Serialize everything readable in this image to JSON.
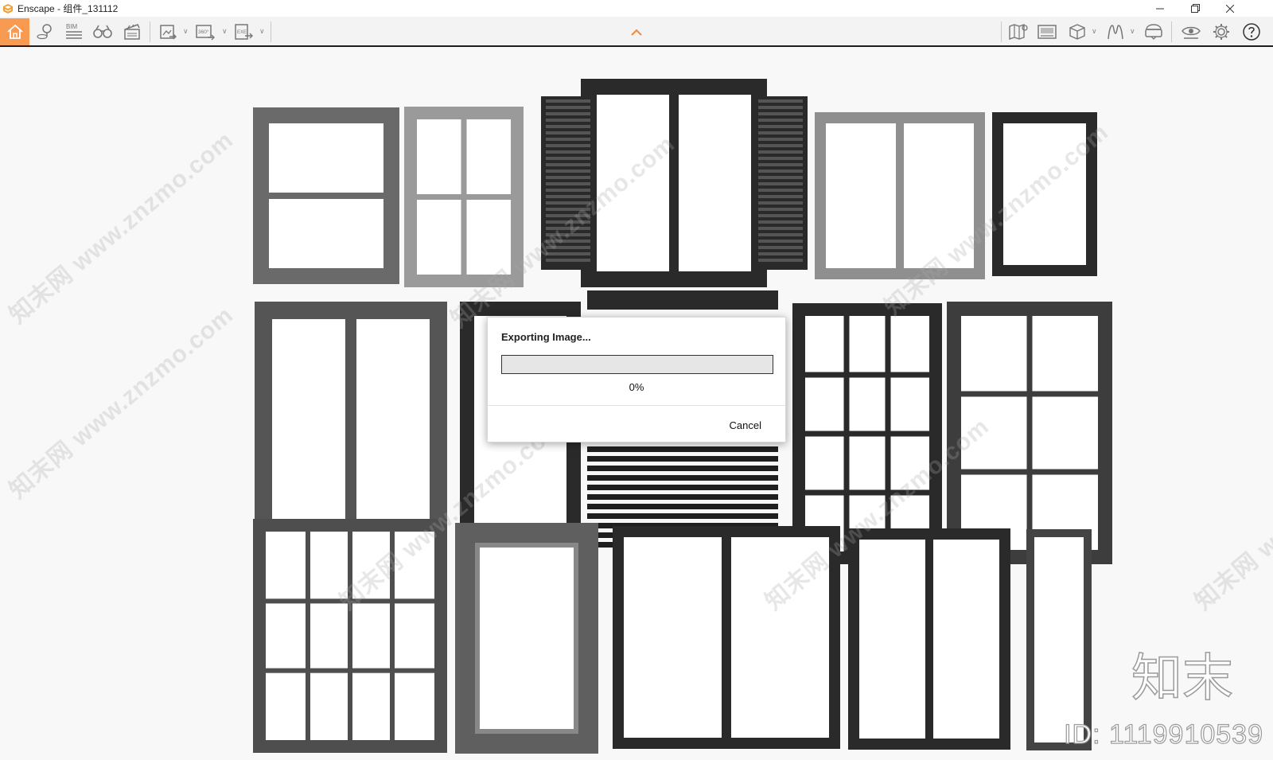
{
  "window": {
    "title": "Enscape - 组件_131112",
    "controls": [
      "minimize-icon",
      "restore-icon",
      "close-icon"
    ]
  },
  "toolbar": {
    "left": [
      {
        "name": "home-icon",
        "active": true
      },
      {
        "name": "map-pin-icon"
      },
      {
        "name": "bim-icon",
        "label": "BIM"
      },
      {
        "name": "binoculars-icon"
      },
      {
        "name": "clapperboard-icon"
      },
      {
        "name": "screenshot-export-icon",
        "dropdown": true
      },
      {
        "name": "panorama-export-icon",
        "label": "360°",
        "dropdown": true
      },
      {
        "name": "exe-export-icon",
        "label": "EXE",
        "dropdown": true
      }
    ],
    "center": {
      "name": "chevron-up-icon"
    },
    "right": [
      {
        "name": "map-icon"
      },
      {
        "name": "views-icon"
      },
      {
        "name": "cube-icon",
        "dropdown": true
      },
      {
        "name": "material-editor-icon",
        "dropdown": true
      },
      {
        "name": "vr-headset-icon"
      },
      {
        "name": "visual-settings-icon"
      },
      {
        "name": "settings-gear-icon"
      },
      {
        "name": "help-icon"
      }
    ],
    "accent": "#f79a52"
  },
  "dialog": {
    "title": "Exporting Image...",
    "progress": 0,
    "progress_text": "0%",
    "cancel_label": "Cancel"
  },
  "overlay": {
    "watermark": "知末网 www.znzmo.com",
    "brand": "知末",
    "id_label": "ID: 1119910539"
  }
}
